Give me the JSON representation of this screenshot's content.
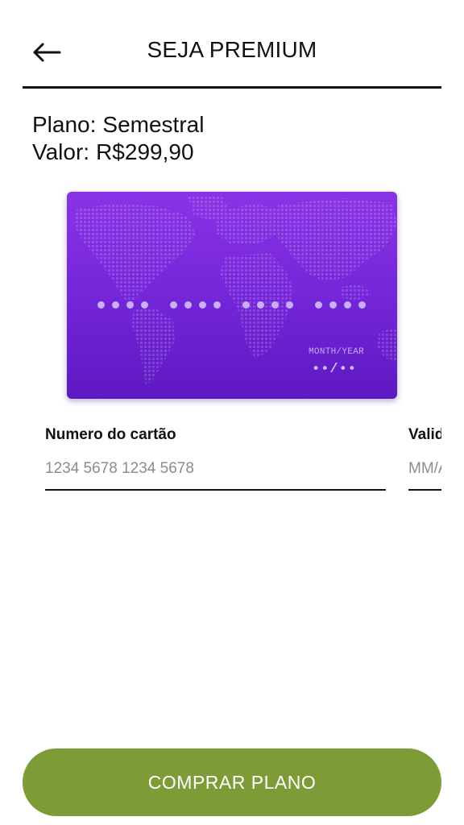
{
  "header": {
    "title": "SEJA PREMIUM",
    "back_icon": "arrow-left-icon"
  },
  "plan": {
    "plan_label": "Plano:",
    "plan_value": "Semestral",
    "price_label": "Valor:",
    "price_value": "R$299,90"
  },
  "card_preview": {
    "month_year_label": "MONTH/YEAR",
    "expiry_placeholder": "••/••",
    "color_top": "#8a33e6",
    "color_bottom": "#5e19c2"
  },
  "form": {
    "card_number": {
      "label": "Numero do cartão",
      "placeholder": "1234 5678 1234 5678",
      "value": ""
    },
    "validity": {
      "label": "Validade",
      "placeholder": "MM/AA",
      "value": ""
    }
  },
  "buy_button": {
    "label": "COMPRAR PLANO",
    "color": "#7d9c38"
  }
}
